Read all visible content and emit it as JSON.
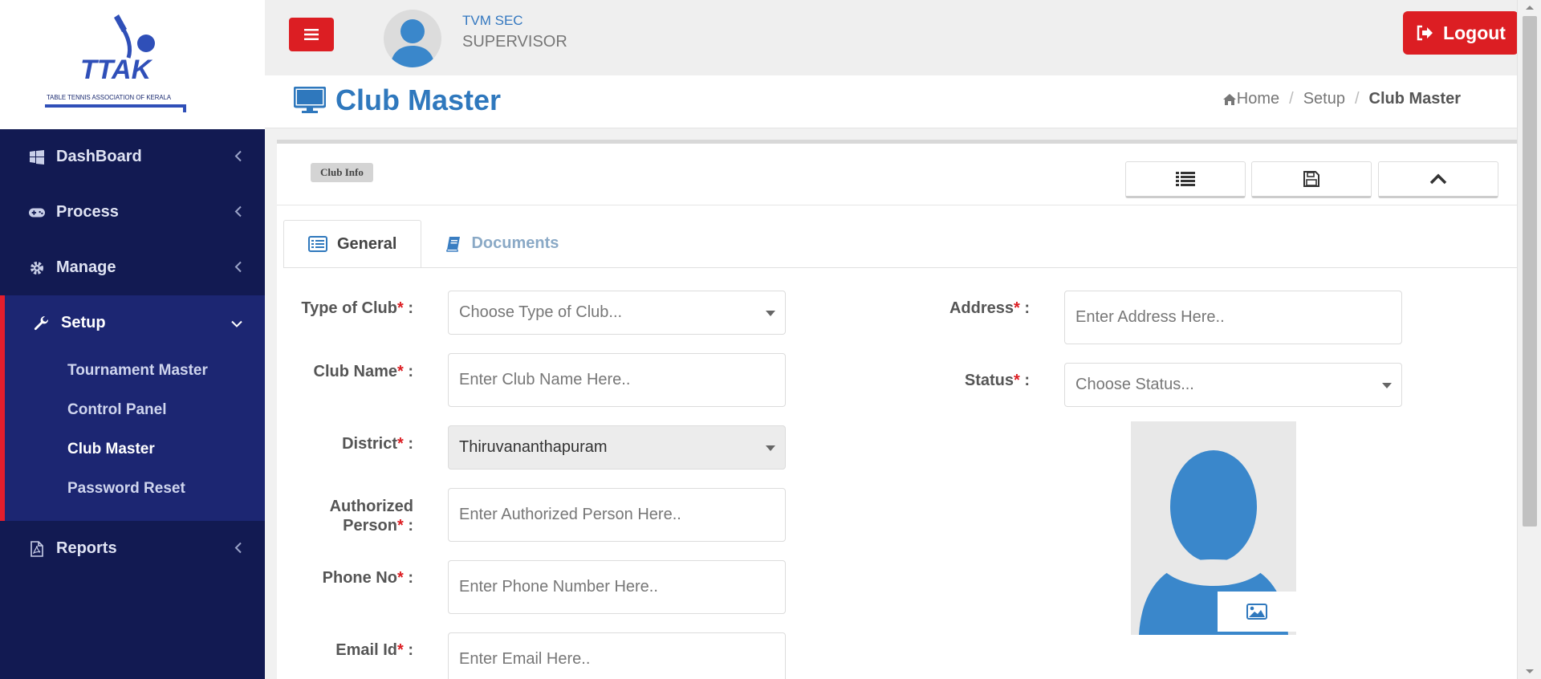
{
  "brand": {
    "logo_text": "TTAK",
    "logo_subtext": "TABLE TENNIS ASSOCIATION OF KERALA"
  },
  "sidebar": {
    "items": [
      {
        "label": "DashBoard",
        "icon": "windows-icon"
      },
      {
        "label": "Process",
        "icon": "gamepad-icon"
      },
      {
        "label": "Manage",
        "icon": "gear-icon"
      },
      {
        "label": "Setup",
        "icon": "wrench-icon",
        "expanded": true,
        "children": [
          {
            "label": "Tournament Master"
          },
          {
            "label": "Control Panel"
          },
          {
            "label": "Club Master",
            "active": true
          },
          {
            "label": "Password Reset"
          }
        ]
      },
      {
        "label": "Reports",
        "icon": "pdf-file-icon"
      }
    ]
  },
  "topbar": {
    "user_name": "TVM SEC",
    "user_role": "SUPERVISOR",
    "logout_label": "Logout"
  },
  "header": {
    "title": "Club Master",
    "breadcrumb": [
      "Home",
      "Setup",
      "Club Master"
    ]
  },
  "panel": {
    "badge": "Club Info",
    "tabs": [
      {
        "label": "General",
        "active": true,
        "icon": "list-alt-icon"
      },
      {
        "label": "Documents",
        "active": false,
        "icon": "book-icon"
      }
    ]
  },
  "form": {
    "type_of_club": {
      "label": "Type of Club",
      "placeholder": "Choose Type of Club..."
    },
    "club_name": {
      "label": "Club Name",
      "placeholder": "Enter Club Name Here.."
    },
    "district": {
      "label": "District",
      "value": "Thiruvananthapuram"
    },
    "authorized_person": {
      "label_line1": "Authorized",
      "label_line2": "Person",
      "placeholder": "Enter Authorized Person Here.."
    },
    "phone": {
      "label": "Phone No",
      "placeholder": "Enter Phone Number Here.."
    },
    "email": {
      "label": "Email Id",
      "placeholder": "Enter Email Here.."
    },
    "address": {
      "label": "Address",
      "placeholder": "Enter Address Here.."
    },
    "status": {
      "label": "Status",
      "placeholder": "Choose Status..."
    },
    "required_mark": "*",
    "colon": " :"
  },
  "colors": {
    "sidebar_bg": "#121a52",
    "accent_red": "#dc1e23",
    "title_blue": "#2f78bd"
  }
}
